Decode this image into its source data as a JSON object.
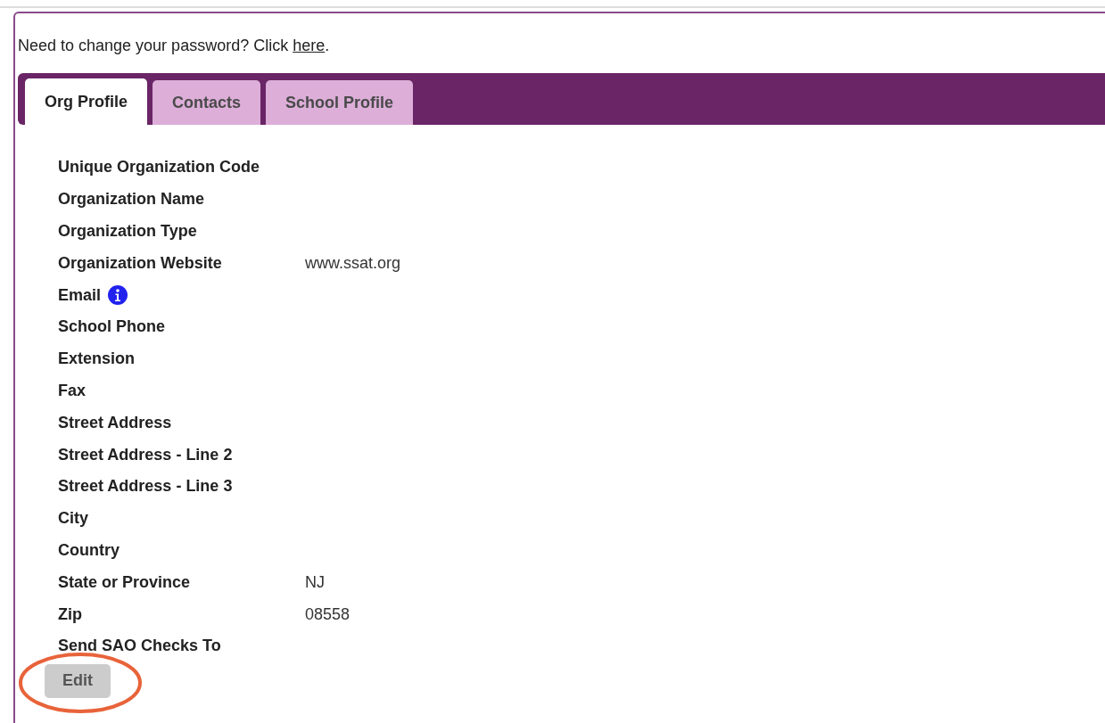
{
  "password_notice": {
    "text": "Need to change your password? Click ",
    "link": "here",
    "end": "."
  },
  "tabs": [
    {
      "label": "Org Profile",
      "selected": true
    },
    {
      "label": "Contacts",
      "selected": false
    },
    {
      "label": "School Profile",
      "selected": false
    }
  ],
  "fields": [
    {
      "label": "Unique Organization Code"
    },
    {
      "label": "Organization Name"
    },
    {
      "label": "Organization Type"
    },
    {
      "label": "Organization Website",
      "value": "www.ssat.org"
    },
    {
      "label": "Email",
      "info": true
    },
    {
      "label": "School Phone"
    },
    {
      "label": "Extension"
    },
    {
      "label": "Fax"
    },
    {
      "label": "Street Address"
    },
    {
      "label": "Street Address - Line 2"
    },
    {
      "label": "Street Address - Line 3"
    },
    {
      "label": "City"
    },
    {
      "label": "Country"
    },
    {
      "label": "State or Province",
      "value": "NJ"
    },
    {
      "label": "Zip",
      "value": "08558"
    },
    {
      "label": "Send SAO Checks To"
    }
  ],
  "edit_button": {
    "label": "Edit",
    "highlighted": true
  }
}
